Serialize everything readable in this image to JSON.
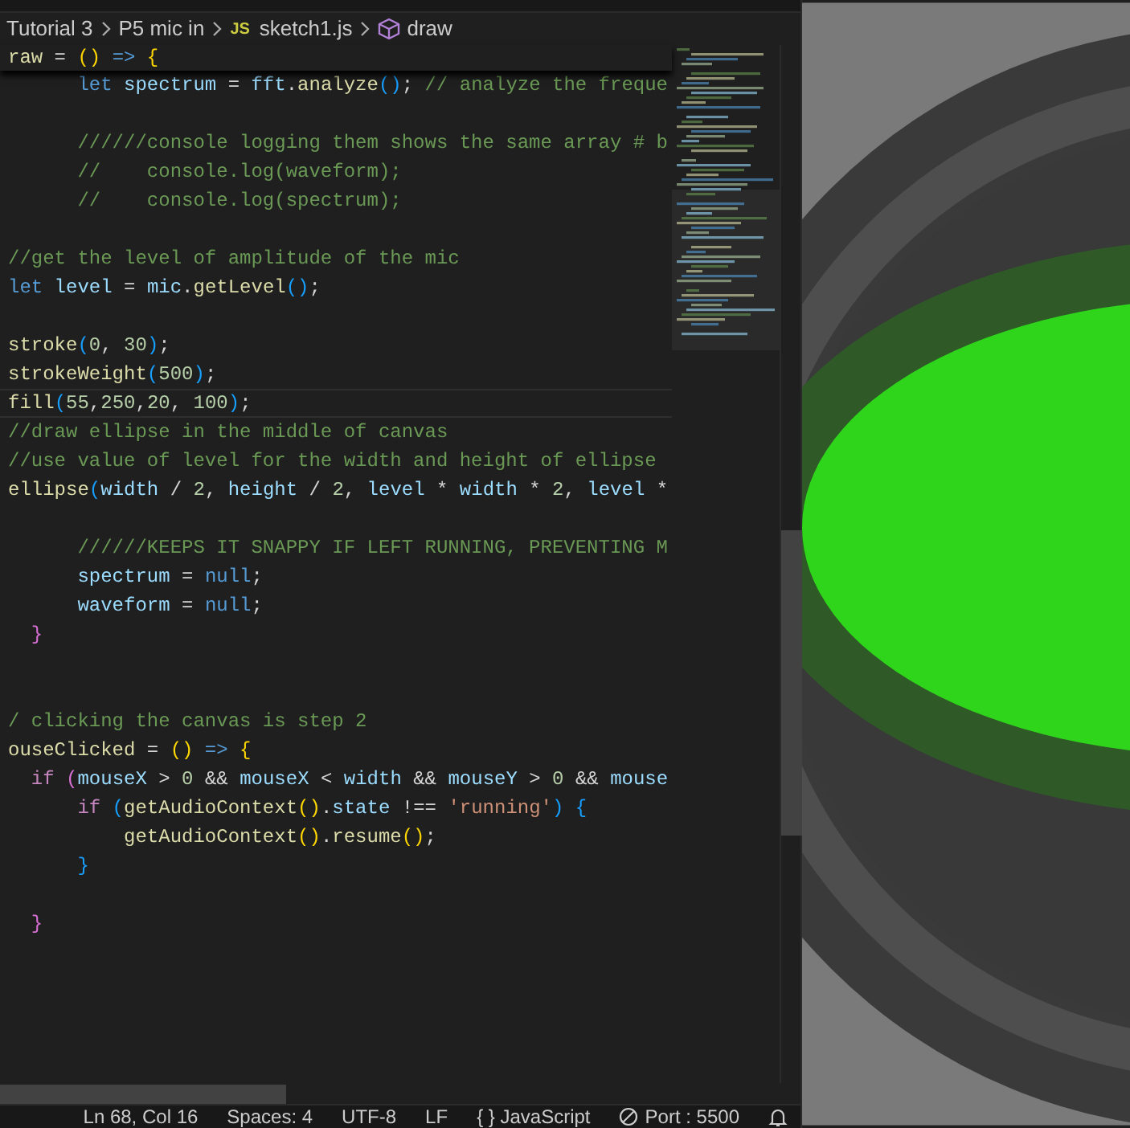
{
  "breadcrumb": [
    {
      "kind": "folder",
      "label": "Tutorial 3"
    },
    {
      "kind": "folder",
      "label": "P5 mic in"
    },
    {
      "kind": "file",
      "icon_text": "JS",
      "label": "sketch1.js"
    },
    {
      "kind": "symbol",
      "label": "draw"
    }
  ],
  "sticky_line": {
    "tokens": [
      {
        "text": "raw",
        "kind": "fn"
      },
      {
        "text": " = ",
        "kind": "p"
      },
      {
        "text": "()",
        "kind": "b1"
      },
      {
        "text": " =>",
        "kind": "kw"
      },
      {
        "text": " {",
        "kind": "b1"
      }
    ]
  },
  "code_lines": [
    {
      "kind": "code",
      "current": false,
      "tokens": [
        {
          "text": "      let",
          "kind": "kw"
        },
        {
          "text": " spectrum",
          "kind": "var"
        },
        {
          "text": " = ",
          "kind": "p"
        },
        {
          "text": "fft",
          "kind": "var"
        },
        {
          "text": ".",
          "kind": "p"
        },
        {
          "text": "analyze",
          "kind": "fn"
        },
        {
          "text": "()",
          "kind": "b3"
        },
        {
          "text": "; ",
          "kind": "p"
        },
        {
          "text": "// analyze the freque",
          "kind": "cmt"
        }
      ]
    },
    {
      "kind": "blank"
    },
    {
      "kind": "code",
      "current": false,
      "tokens": [
        {
          "text": "      //////console logging them shows the same array # b",
          "kind": "cmt"
        }
      ]
    },
    {
      "kind": "code",
      "current": false,
      "tokens": [
        {
          "text": "      //    console.log(waveform);",
          "kind": "cmt"
        }
      ]
    },
    {
      "kind": "code",
      "current": false,
      "tokens": [
        {
          "text": "      //    console.log(spectrum);",
          "kind": "cmt"
        }
      ]
    },
    {
      "kind": "blank"
    },
    {
      "kind": "code",
      "current": false,
      "tokens": [
        {
          "text": "//get the level of amplitude of the mic",
          "kind": "cmt"
        }
      ]
    },
    {
      "kind": "code",
      "current": false,
      "tokens": [
        {
          "text": "let",
          "kind": "kw"
        },
        {
          "text": " level",
          "kind": "var"
        },
        {
          "text": " = ",
          "kind": "p"
        },
        {
          "text": "mic",
          "kind": "var"
        },
        {
          "text": ".",
          "kind": "p"
        },
        {
          "text": "getLevel",
          "kind": "fn"
        },
        {
          "text": "()",
          "kind": "b3"
        },
        {
          "text": ";",
          "kind": "p"
        }
      ]
    },
    {
      "kind": "blank"
    },
    {
      "kind": "code",
      "current": false,
      "tokens": [
        {
          "text": "stroke",
          "kind": "fn"
        },
        {
          "text": "(",
          "kind": "b3"
        },
        {
          "text": "0",
          "kind": "num"
        },
        {
          "text": ", ",
          "kind": "p"
        },
        {
          "text": "30",
          "kind": "num"
        },
        {
          "text": ")",
          "kind": "b3"
        },
        {
          "text": ";",
          "kind": "p"
        }
      ]
    },
    {
      "kind": "code",
      "current": false,
      "tokens": [
        {
          "text": "strokeWeight",
          "kind": "fn"
        },
        {
          "text": "(",
          "kind": "b3"
        },
        {
          "text": "500",
          "kind": "num"
        },
        {
          "text": ")",
          "kind": "b3"
        },
        {
          "text": ";",
          "kind": "p"
        }
      ]
    },
    {
      "kind": "code",
      "current": true,
      "tokens": [
        {
          "text": "fill",
          "kind": "fn"
        },
        {
          "text": "(",
          "kind": "b3"
        },
        {
          "text": "55",
          "kind": "num"
        },
        {
          "text": ",",
          "kind": "p"
        },
        {
          "text": "250",
          "kind": "num"
        },
        {
          "text": ",",
          "kind": "p"
        },
        {
          "text": "20",
          "kind": "num"
        },
        {
          "text": ", ",
          "kind": "p"
        },
        {
          "text": "100",
          "kind": "num"
        },
        {
          "text": ")",
          "kind": "b3"
        },
        {
          "text": ";",
          "kind": "p"
        }
      ]
    },
    {
      "kind": "code",
      "current": false,
      "tokens": [
        {
          "text": "//draw ellipse in the middle of canvas",
          "kind": "cmt"
        }
      ]
    },
    {
      "kind": "code",
      "current": false,
      "tokens": [
        {
          "text": "//use value of level for the width and height of ellipse",
          "kind": "cmt"
        }
      ]
    },
    {
      "kind": "code",
      "current": false,
      "tokens": [
        {
          "text": "ellipse",
          "kind": "fn"
        },
        {
          "text": "(",
          "kind": "b3"
        },
        {
          "text": "width",
          "kind": "var"
        },
        {
          "text": " / ",
          "kind": "p"
        },
        {
          "text": "2",
          "kind": "num"
        },
        {
          "text": ", ",
          "kind": "p"
        },
        {
          "text": "height",
          "kind": "var"
        },
        {
          "text": " / ",
          "kind": "p"
        },
        {
          "text": "2",
          "kind": "num"
        },
        {
          "text": ", ",
          "kind": "p"
        },
        {
          "text": "level",
          "kind": "var"
        },
        {
          "text": " * ",
          "kind": "p"
        },
        {
          "text": "width",
          "kind": "var"
        },
        {
          "text": " * ",
          "kind": "p"
        },
        {
          "text": "2",
          "kind": "num"
        },
        {
          "text": ", ",
          "kind": "p"
        },
        {
          "text": "level",
          "kind": "var"
        },
        {
          "text": " *",
          "kind": "p"
        }
      ]
    },
    {
      "kind": "blank"
    },
    {
      "kind": "code",
      "current": false,
      "tokens": [
        {
          "text": "      //////KEEPS IT SNAPPY IF LEFT RUNNING, PREVENTING M",
          "kind": "cmt"
        }
      ]
    },
    {
      "kind": "code",
      "current": false,
      "tokens": [
        {
          "text": "      spectrum",
          "kind": "var"
        },
        {
          "text": " = ",
          "kind": "p"
        },
        {
          "text": "null",
          "kind": "kw"
        },
        {
          "text": ";",
          "kind": "p"
        }
      ]
    },
    {
      "kind": "code",
      "current": false,
      "tokens": [
        {
          "text": "      waveform",
          "kind": "var"
        },
        {
          "text": " = ",
          "kind": "p"
        },
        {
          "text": "null",
          "kind": "kw"
        },
        {
          "text": ";",
          "kind": "p"
        }
      ]
    },
    {
      "kind": "code",
      "current": false,
      "tokens": [
        {
          "text": "  }",
          "kind": "b2"
        }
      ]
    },
    {
      "kind": "blank"
    },
    {
      "kind": "blank"
    },
    {
      "kind": "code",
      "current": false,
      "tokens": [
        {
          "text": "/ clicking the canvas is step 2",
          "kind": "cmt"
        }
      ]
    },
    {
      "kind": "code",
      "current": false,
      "tokens": [
        {
          "text": "ouseClicked",
          "kind": "fn"
        },
        {
          "text": " = ",
          "kind": "p"
        },
        {
          "text": "()",
          "kind": "b1"
        },
        {
          "text": " =>",
          "kind": "kw"
        },
        {
          "text": " {",
          "kind": "b1"
        }
      ]
    },
    {
      "kind": "code",
      "current": false,
      "tokens": [
        {
          "text": "  if",
          "kind": "ctrl"
        },
        {
          "text": " (",
          "kind": "b2"
        },
        {
          "text": "mouseX",
          "kind": "var"
        },
        {
          "text": " > ",
          "kind": "p"
        },
        {
          "text": "0",
          "kind": "num"
        },
        {
          "text": " && ",
          "kind": "p"
        },
        {
          "text": "mouseX",
          "kind": "var"
        },
        {
          "text": " < ",
          "kind": "p"
        },
        {
          "text": "width",
          "kind": "var"
        },
        {
          "text": " && ",
          "kind": "p"
        },
        {
          "text": "mouseY",
          "kind": "var"
        },
        {
          "text": " > ",
          "kind": "p"
        },
        {
          "text": "0",
          "kind": "num"
        },
        {
          "text": " && ",
          "kind": "p"
        },
        {
          "text": "mouse",
          "kind": "var"
        }
      ]
    },
    {
      "kind": "code",
      "current": false,
      "tokens": [
        {
          "text": "      if",
          "kind": "ctrl"
        },
        {
          "text": " (",
          "kind": "b3"
        },
        {
          "text": "getAudioContext",
          "kind": "fn"
        },
        {
          "text": "()",
          "kind": "b1"
        },
        {
          "text": ".",
          "kind": "p"
        },
        {
          "text": "state",
          "kind": "var"
        },
        {
          "text": " !== ",
          "kind": "p"
        },
        {
          "text": "'running'",
          "kind": "str"
        },
        {
          "text": ")",
          "kind": "b3"
        },
        {
          "text": " {",
          "kind": "b3"
        }
      ]
    },
    {
      "kind": "code",
      "current": false,
      "tokens": [
        {
          "text": "          getAudioContext",
          "kind": "fn"
        },
        {
          "text": "()",
          "kind": "b1"
        },
        {
          "text": ".",
          "kind": "p"
        },
        {
          "text": "resume",
          "kind": "fn"
        },
        {
          "text": "()",
          "kind": "b1"
        },
        {
          "text": ";",
          "kind": "p"
        }
      ]
    },
    {
      "kind": "code",
      "current": false,
      "tokens": [
        {
          "text": "      }",
          "kind": "b3"
        }
      ]
    },
    {
      "kind": "blank"
    },
    {
      "kind": "code",
      "current": false,
      "tokens": [
        {
          "text": "  }",
          "kind": "b2"
        }
      ]
    }
  ],
  "status_bar": [
    {
      "kind": "text",
      "text": "Ln 68, Col 16"
    },
    {
      "kind": "text",
      "text": "Spaces: 4"
    },
    {
      "kind": "text",
      "text": "UTF-8"
    },
    {
      "kind": "text",
      "text": "LF"
    },
    {
      "kind": "language",
      "prefix": "{ }",
      "text": "JavaScript"
    },
    {
      "kind": "port",
      "text": "Port : 5500"
    },
    {
      "kind": "bell"
    }
  ]
}
